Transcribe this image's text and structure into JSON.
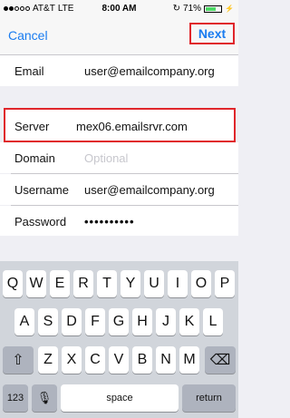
{
  "status": {
    "carrier": "AT&T",
    "network": "LTE",
    "time": "8:00 AM",
    "battery": "71%",
    "battery_level": 0.71
  },
  "nav": {
    "cancel_label": "Cancel",
    "next_label": "Next"
  },
  "form": {
    "email": {
      "label": "Email",
      "value": "user@emailcompany.org"
    },
    "server": {
      "label": "Server",
      "value": "mex06.emailsrvr.com"
    },
    "domain": {
      "label": "Domain",
      "placeholder": "Optional"
    },
    "username": {
      "label": "Username",
      "value": "user@emailcompany.org"
    },
    "password": {
      "label": "Password",
      "value": "••••••••••"
    }
  },
  "keyboard": {
    "row1": [
      "Q",
      "W",
      "E",
      "R",
      "T",
      "Y",
      "U",
      "I",
      "O",
      "P"
    ],
    "row2": [
      "A",
      "S",
      "D",
      "F",
      "G",
      "H",
      "J",
      "K",
      "L"
    ],
    "row3": [
      "Z",
      "X",
      "C",
      "V",
      "B",
      "N",
      "M"
    ],
    "shift_icon": "⇧",
    "delete_icon": "⌫",
    "numbers_label": "123",
    "mic_icon": "🎙",
    "space_label": "space",
    "return_label": "return"
  }
}
